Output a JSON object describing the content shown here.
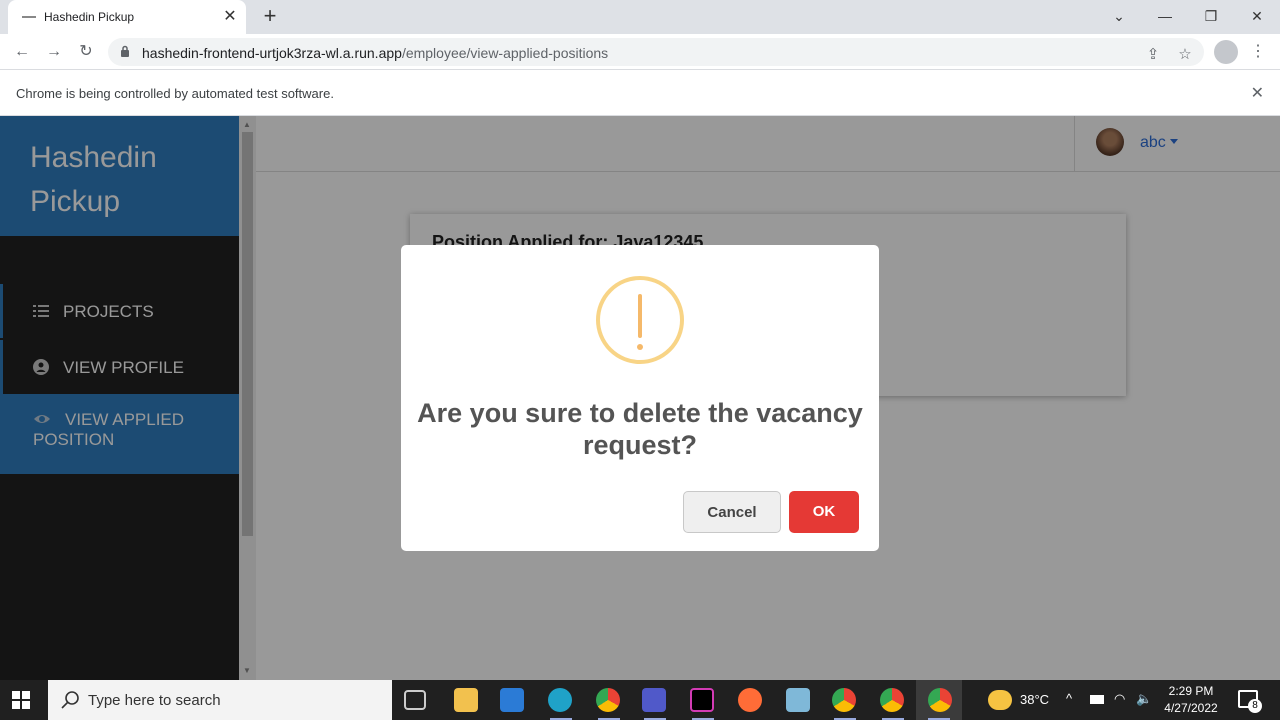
{
  "browser": {
    "tab_title": "Hashedin Pickup",
    "url_host": "hashedin-frontend-urtjok3rza-wl.a.run.app",
    "url_path": "/employee/view-applied-positions",
    "infobar_message": "Chrome is being controlled by automated test software."
  },
  "app": {
    "brand_line1": "Hashedin",
    "brand_line2": "Pickup",
    "nav": [
      {
        "label": "PROJECTS",
        "icon": "list-icon"
      },
      {
        "label": "VIEW PROFILE",
        "icon": "user-circle-icon"
      },
      {
        "label_line1": "VIEW APPLIED",
        "label_line2": "POSITION",
        "icon": "eye-icon",
        "active": true
      }
    ],
    "user": {
      "name": "abc"
    },
    "card_heading": "Position Applied for:  Java12345"
  },
  "dialog": {
    "question_line1": "Are you sure to delete the vacancy",
    "question_line2": "request?",
    "cancel_label": "Cancel",
    "ok_label": "OK"
  },
  "taskbar": {
    "search_placeholder": "Type here to search",
    "weather": "38°C",
    "time": "2:29 PM",
    "date": "4/27/2022",
    "notification_count": "8"
  },
  "colors": {
    "brand_blue": "#2f7ec0",
    "sidebar_bg": "#222222",
    "ok_red": "#e53935",
    "warning_orange": "#f8d486"
  }
}
